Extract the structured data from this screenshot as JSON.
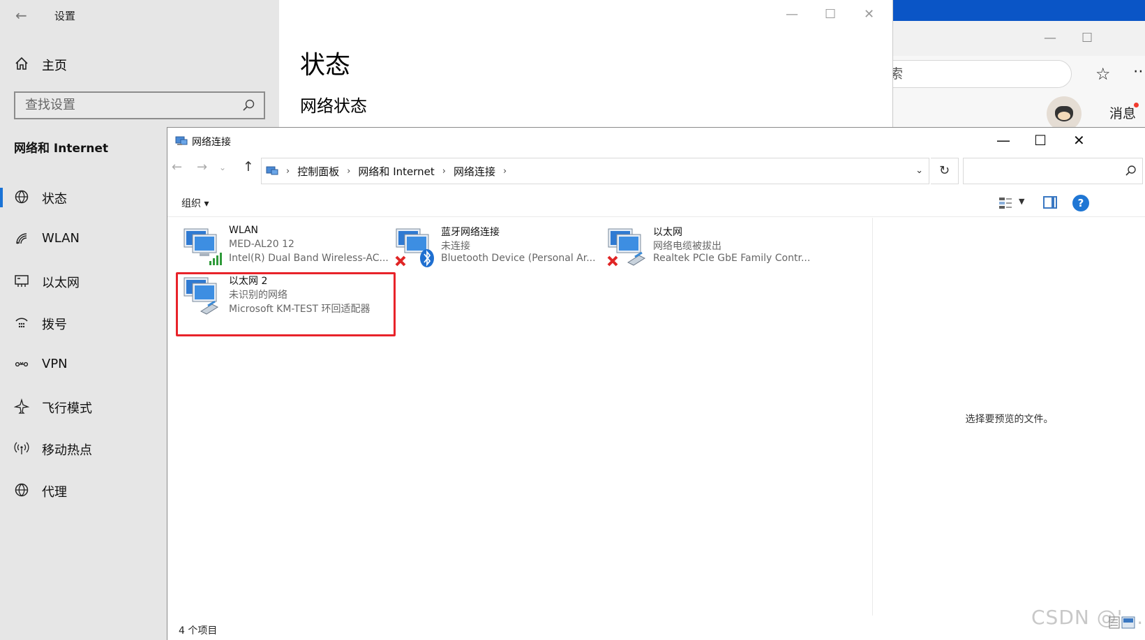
{
  "browser": {
    "search_placeholder": "比搜索",
    "message_label": "消息",
    "minimize_glyph": "—",
    "maximize_glyph": "☐"
  },
  "settings": {
    "window_title": "设置",
    "home_label": "主页",
    "search_placeholder": "查找设置",
    "section_title": "网络和 Internet",
    "nav": [
      {
        "label": "状态",
        "icon": "globe-icon",
        "active": true
      },
      {
        "label": "WLAN",
        "icon": "wifi-icon",
        "active": false
      },
      {
        "label": "以太网",
        "icon": "ethernet-icon",
        "active": false
      },
      {
        "label": "拨号",
        "icon": "dialup-icon",
        "active": false
      },
      {
        "label": "VPN",
        "icon": "vpn-icon",
        "active": false
      },
      {
        "label": "飞行模式",
        "icon": "airplane-icon",
        "active": false
      },
      {
        "label": "移动热点",
        "icon": "hotspot-icon",
        "active": false
      },
      {
        "label": "代理",
        "icon": "proxy-globe-icon",
        "active": false
      }
    ],
    "page_title": "状态",
    "page_subtitle": "网络状态"
  },
  "explorer": {
    "window_title": "网络连接",
    "breadcrumb": [
      "控制面板",
      "网络和 Internet",
      "网络连接"
    ],
    "organize_label": "组织 ▾",
    "help_label": "?",
    "preview_message": "选择要预览的文件。",
    "item_count": "4 个项目",
    "connections": [
      {
        "name": "WLAN",
        "status": "MED-AL20 12",
        "device": "Intel(R) Dual Band Wireless-AC...",
        "badge": "signal-bars-icon",
        "disabled": false
      },
      {
        "name": "蓝牙网络连接",
        "status": "未连接",
        "device": "Bluetooth Device (Personal Ar...",
        "badge": "bluetooth-icon",
        "disabled": true
      },
      {
        "name": "以太网",
        "status": "网络电缆被拔出",
        "device": "Realtek PCIe GbE Family Contr...",
        "badge": "cable-icon",
        "disabled": true
      },
      {
        "name": "以太网 2",
        "status": "未识别的网络",
        "device": "Microsoft KM-TEST 环回适配器",
        "badge": "cable-icon",
        "disabled": false
      }
    ]
  },
  "watermark": "CSDN @'...",
  "colors": {
    "accent": "#1a73d6",
    "highlight_border": "#e8232a",
    "browser_strip": "#0a55c6"
  }
}
